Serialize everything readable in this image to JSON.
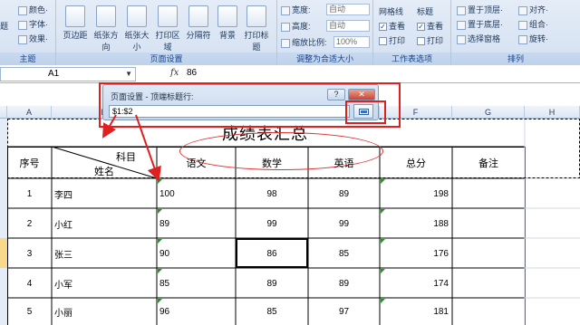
{
  "ribbon": {
    "groups": [
      {
        "label": "主题"
      },
      {
        "label": "页面设置"
      },
      {
        "label": "调整为合适大小"
      },
      {
        "label": "工作表选项"
      },
      {
        "label": "排列"
      }
    ],
    "theme_items": [
      {
        "label": "题",
        "name": "theme-button"
      },
      {
        "label": "颜色·",
        "name": "colors-button"
      },
      {
        "label": "字体·",
        "name": "fonts-button"
      },
      {
        "label": "效果·",
        "name": "effects-button"
      }
    ],
    "page_buttons": [
      {
        "label": "页边距",
        "name": "margins-button"
      },
      {
        "label": "纸张方向",
        "name": "orientation-button"
      },
      {
        "label": "纸张大小",
        "name": "size-button"
      },
      {
        "label": "打印区域",
        "name": "print-area-button"
      },
      {
        "label": "分隔符",
        "name": "breaks-button"
      },
      {
        "label": "背景",
        "name": "background-button"
      },
      {
        "label": "打印标题",
        "name": "print-titles-button"
      }
    ],
    "fit": {
      "width_label": "宽度:",
      "width_value": "自动",
      "height_label": "高度:",
      "height_value": "自动",
      "scale_label": "缩放比例:",
      "scale_value": "100%"
    },
    "sheet_options": {
      "gridlines": "网格线",
      "headings": "标题",
      "view": "查看",
      "print": "打印"
    },
    "arrange": [
      {
        "label": "置于顶层·",
        "name": "bring-forward-button"
      },
      {
        "label": "置于底层·",
        "name": "send-backward-button"
      },
      {
        "label": "选择窗格",
        "name": "selection-pane-button"
      },
      {
        "label": "对齐·",
        "name": "align-button"
      },
      {
        "label": "组合·",
        "name": "group-button"
      },
      {
        "label": "旋转·",
        "name": "rotate-button"
      }
    ]
  },
  "formula_bar": {
    "name_box": "A1",
    "fx": "fx",
    "value": "86"
  },
  "dialog": {
    "title": "页面设置 - 顶端标题行:",
    "help": "?",
    "close": "✕",
    "input_value": "$1:$2"
  },
  "columns": [
    "A",
    "B",
    "C",
    "D",
    "E",
    "F",
    "G",
    "H"
  ],
  "sheet": {
    "title": "成绩表汇总",
    "diag_top": "科目",
    "diag_bottom": "姓名",
    "headers": [
      "序号",
      "语文",
      "数学",
      "英语",
      "总分",
      "备注"
    ],
    "rows": [
      {
        "no": "1",
        "name": "李四",
        "chinese": "100",
        "math": "98",
        "english": "89",
        "total": "198"
      },
      {
        "no": "2",
        "name": "小红",
        "chinese": "89",
        "math": "99",
        "english": "99",
        "total": "188"
      },
      {
        "no": "3",
        "name": "张三",
        "chinese": "90",
        "math": "86",
        "english": "85",
        "total": "176"
      },
      {
        "no": "4",
        "name": "小军",
        "chinese": "85",
        "math": "89",
        "english": "89",
        "total": "174"
      },
      {
        "no": "5",
        "name": "小丽",
        "chinese": "96",
        "math": "85",
        "english": "97",
        "total": "181"
      }
    ]
  },
  "colors": {
    "annotation": "#e02020",
    "selected_row": "#f8d88a"
  }
}
